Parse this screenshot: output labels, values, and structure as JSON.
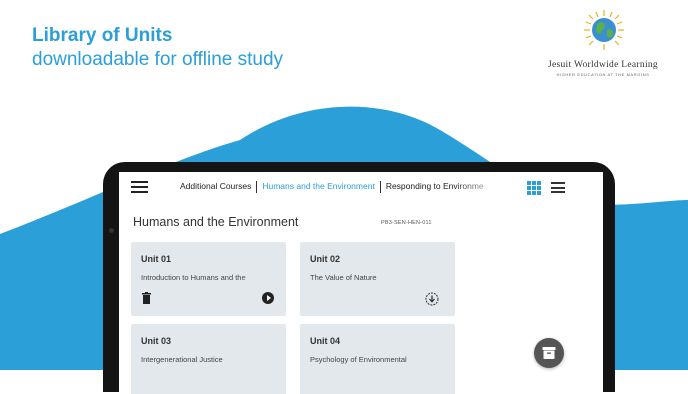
{
  "promo": {
    "headline": "Library of Units",
    "subheadline": "downloadable for offline study"
  },
  "logo": {
    "name": "Jesuit Worldwide Learning",
    "tagline": "HIGHER EDUCATION AT THE MARGINS"
  },
  "app": {
    "tabs": [
      {
        "label": "Additional Courses",
        "active": false
      },
      {
        "label": "Humans and the Environment",
        "active": true
      },
      {
        "label": "Responding to Environme",
        "active": false
      }
    ],
    "page_title": "Humans and the Environment",
    "course_code": "PB3-SEN-HEN-011",
    "units": [
      {
        "title": "Unit 01",
        "description": "Introduction to Humans and the",
        "icons": [
          "trash-icon",
          "play-icon"
        ]
      },
      {
        "title": "Unit 02",
        "description": "The Value of Nature",
        "icons": [
          "download-icon"
        ]
      },
      {
        "title": "Unit 03",
        "description": "Intergenerational Justice",
        "icons": []
      },
      {
        "title": "Unit 04",
        "description": "Psychology of Environmental",
        "icons": []
      }
    ],
    "view_icons": [
      "grid-view-icon",
      "list-view-icon"
    ],
    "fab_icon": "archive-icon"
  },
  "colors": {
    "accent": "#2a9fd8",
    "card": "#e3e8ec",
    "device": "#141414"
  }
}
